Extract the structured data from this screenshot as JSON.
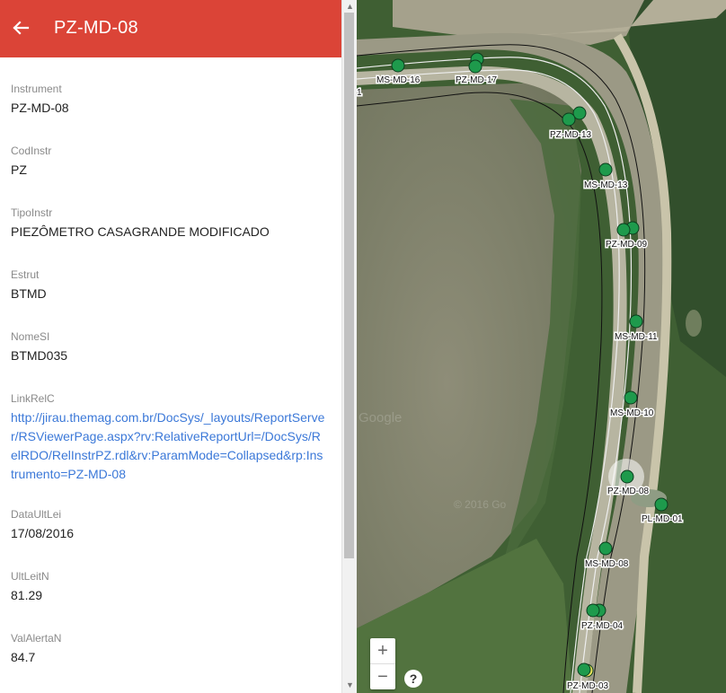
{
  "panel": {
    "back_icon": "arrow-left-icon",
    "title": "PZ-MD-08",
    "header_color": "#db4437",
    "fields": [
      {
        "label": "Instrument",
        "value": "PZ-MD-08"
      },
      {
        "label": "CodInstr",
        "value": "PZ"
      },
      {
        "label": "TipoInstr",
        "value": "PIEZÔMETRO CASAGRANDE MODIFICADO"
      },
      {
        "label": "Estrut",
        "value": "BTMD"
      },
      {
        "label": "NomeSI",
        "value": "BTMD035"
      },
      {
        "label": "LinkRelC",
        "value": "http://jirau.themag.com.br/DocSys/_layouts/ReportServer/RSViewerPage.aspx?rv:RelativeReportUrl=/DocSys/RelRDO/RelInstrPZ.rdl&rv:ParamMode=Collapsed&rp:Instrumento=PZ-MD-08"
      },
      {
        "label": "DataUltLei",
        "value": "17/08/2016"
      },
      {
        "label": "UltLeitN",
        "value": "81.29"
      },
      {
        "label": "ValAlertaN",
        "value": "84.7"
      }
    ]
  },
  "map": {
    "marker_color": "#1e9a4c",
    "markers": [
      {
        "name": "MS-MD-16"
      },
      {
        "name": "PZ-MD-17"
      },
      {
        "name": "PZ-MD-13"
      },
      {
        "name": "MS-MD-13"
      },
      {
        "name": "PZ-MD-09"
      },
      {
        "name": "MS-MD-11"
      },
      {
        "name": "MS-MD-10"
      },
      {
        "name": "PZ-MD-08",
        "selected": true
      },
      {
        "name": "PL-MD-01"
      },
      {
        "name": "MS-MD-08"
      },
      {
        "name": "PZ-MD-04"
      },
      {
        "name": "PZ-MD-03"
      }
    ],
    "edge_label": "1",
    "watermark": "Google",
    "copyright": "© 2016 Go",
    "zoom_in": "+",
    "zoom_out": "−",
    "help": "?"
  }
}
